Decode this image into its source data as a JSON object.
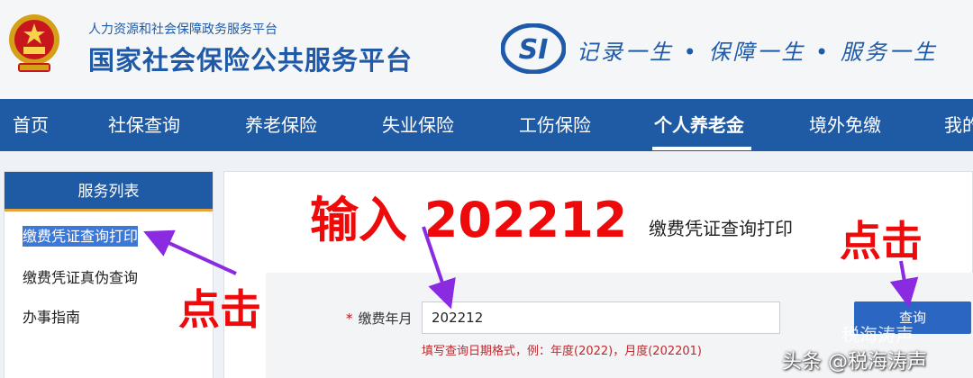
{
  "header": {
    "sub_title": "人力资源和社会保障政务服务平台",
    "main_title": "国家社会保险公共服务平台",
    "slogan": "记录一生 • 保障一生 • 服务一生",
    "logo_text": "SI"
  },
  "nav": {
    "items": [
      {
        "label": "首页"
      },
      {
        "label": "社保查询"
      },
      {
        "label": "养老保险"
      },
      {
        "label": "失业保险"
      },
      {
        "label": "工伤保险"
      },
      {
        "label": "个人养老金",
        "active": true
      },
      {
        "label": "境外免缴"
      },
      {
        "label": "我的"
      }
    ]
  },
  "sidebar": {
    "title": "服务列表",
    "items": [
      {
        "label": "缴费凭证查询打印",
        "selected": true
      },
      {
        "label": "缴费凭证真伪查询"
      },
      {
        "label": "办事指南"
      }
    ]
  },
  "main": {
    "page_title": "缴费凭证查询打印",
    "field_label": "缴费年月",
    "required_mark": "*",
    "field_value": "202212",
    "hint": "填写查询日期格式，例：年度(2022)，月度(202201)",
    "query_button": "查询"
  },
  "annotations": {
    "input_note": "输入 202212",
    "click_note_right": "点击",
    "click_note_left": "点击",
    "color": "#ee0a0a",
    "arrow_color": "#8a2be2"
  },
  "watermark": {
    "top": "税海涛声",
    "bottom": "头条 @税海涛声"
  },
  "colors": {
    "nav_blue": "#1f5aa5",
    "title_blue": "#1e5aa8",
    "button_blue": "#2b66c3",
    "hint_red": "#c0282d"
  }
}
